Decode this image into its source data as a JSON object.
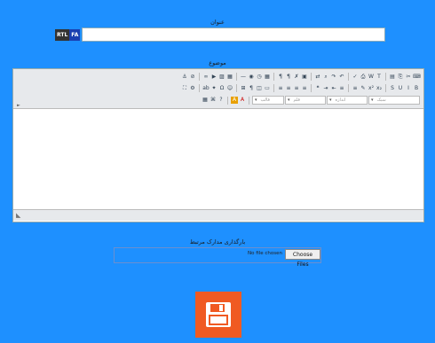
{
  "form": {
    "title_label": "عنوان",
    "title_value": "",
    "rtl_button": "RTL",
    "lang_button": "FA",
    "subject_label": "موضوع",
    "attach_label": "بارگذاری مدارک مرتبط",
    "no_file_text": "No file chosen",
    "choose_button": "Choose Files"
  },
  "toolbar": {
    "row1": [
      "source",
      "cut",
      "copy",
      "paste",
      "paste-text",
      "paste-word",
      "print",
      "spellcheck",
      "undo",
      "redo",
      "find",
      "replace",
      "select-all",
      "remove-format",
      "rtl",
      "ltr",
      "insert-date",
      "insert-time",
      "preview",
      "hr",
      "table",
      "image",
      "media",
      "link",
      "unlink",
      "anchor"
    ],
    "row2": [
      "bold",
      "italic",
      "underline",
      "strike",
      "subscript",
      "superscript",
      "cleanup",
      "numlist",
      "bullist",
      "outdent",
      "indent",
      "blockquote",
      "justify-left",
      "justify-center",
      "justify-right",
      "justify-full",
      "insert-layer",
      "absolute",
      "styleprops",
      "pagebreak",
      "emotions",
      "charmap",
      "special",
      "abbr",
      "attribs",
      "fullscreen"
    ],
    "row3": {
      "format_select": "قالب",
      "font_select": "قلم",
      "size_select": "اندازه",
      "style_select": "سبک",
      "text_color": "A",
      "bg_color": "A",
      "extra": [
        "help",
        "code",
        "visualaid"
      ]
    },
    "arrow": "►"
  },
  "status": {
    "resize": "◣"
  },
  "colors": {
    "background": "#1e90ff",
    "save": "#f05a22"
  }
}
